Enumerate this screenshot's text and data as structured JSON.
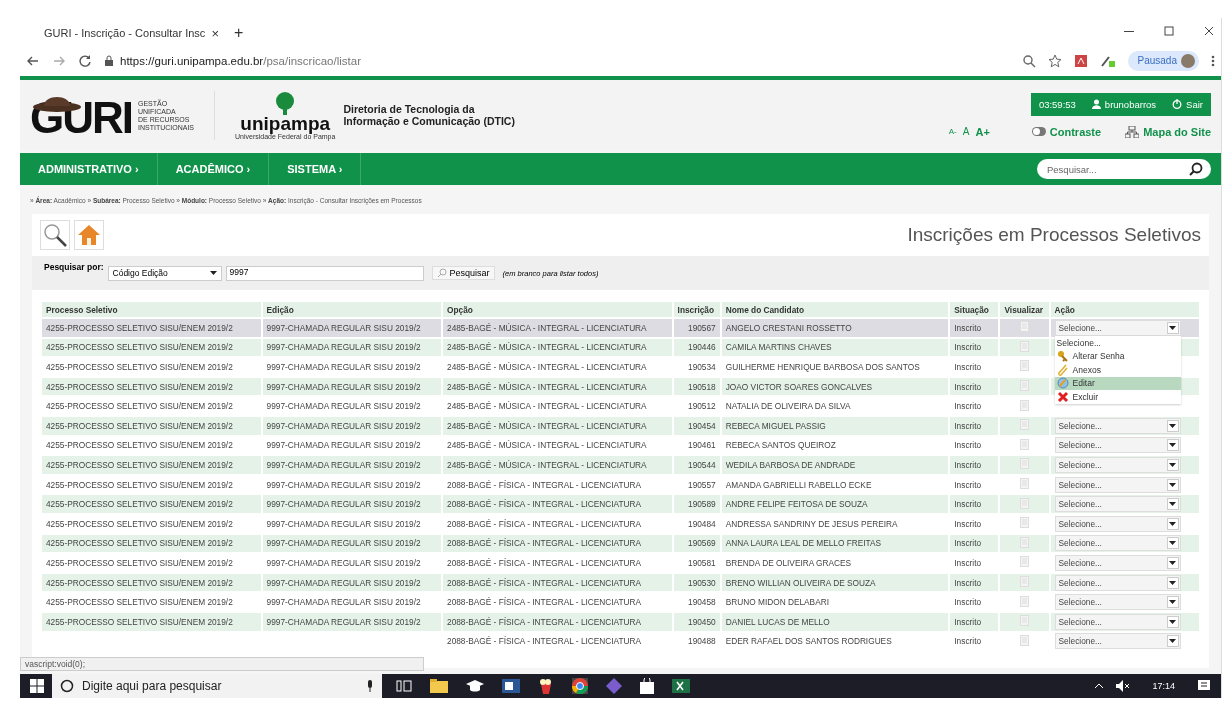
{
  "browser": {
    "tab_title": "GURI - Inscrição - Consultar Insc",
    "tab_close": "×",
    "new_tab": "+",
    "url_host": "https://guri.unipampa.edu.br",
    "url_path": "/psa/inscricao/listar",
    "profile": "Pausada"
  },
  "header": {
    "logo": "GURI",
    "tagline": [
      "GESTÃO",
      "UNIFICADA",
      "DE RECURSOS",
      "INSTITUCIONAIS"
    ],
    "uni_name": "unipampa",
    "uni_sub": "Universidade Federal do Pampa",
    "department": [
      "Diretoria de Tecnologia da",
      "Informação e Comunicação (DTIC)"
    ],
    "timer": "03:59:53",
    "user": "brunobarros",
    "logout": "Sair",
    "font_sizes": [
      "A-",
      "A",
      "A+"
    ],
    "contrast": "Contraste",
    "sitemap": "Mapa do Site"
  },
  "nav": {
    "items": [
      "ADMINISTRATIVO ›",
      "ACADÊMICO ›",
      "SISTEMA ›"
    ],
    "search_placeholder": "Pesquisar..."
  },
  "breadcrumb": "» **Área:** Acadêmico » **Subárea:** Processo Seletivo » **Módulo:** Processo Seletivo » **Ação:** Inscrição - Consultar Inscrições em Processos",
  "page_title": "Inscrições em Processos Seletivos",
  "search": {
    "label": "Pesquisar por:",
    "field": "Código Edição",
    "value": "9997",
    "button": "Pesquisar",
    "hint": "(em branco para listar todos)"
  },
  "table": {
    "columns": [
      "Processo Seletivo",
      "Edição",
      "Opção",
      "Inscrição",
      "Nome do Candidato",
      "Situação",
      "Visualizar",
      "Ação"
    ],
    "rows": [
      {
        "processo": "4255-PROCESSO SELETIVO SISU/ENEM 2019/2",
        "edicao": "9997-CHAMADA REGULAR SISU 2019/2",
        "opcao": "2485-BAGÉ - MÚSICA - INTEGRAL - LICENCIATURA",
        "inscricao": "190567",
        "nome": "ANGELO CRESTANI ROSSETTO",
        "situacao": "Inscrito",
        "acao": "Selecione...",
        "selected": true
      },
      {
        "processo": "4255-PROCESSO SELETIVO SISU/ENEM 2019/2",
        "edicao": "9997-CHAMADA REGULAR SISU 2019/2",
        "opcao": "2485-BAGÉ - MÚSICA - INTEGRAL - LICENCIATURA",
        "inscricao": "190446",
        "nome": "CAMILA MARTINS CHAVES",
        "situacao": "Inscrito",
        "selected": false
      },
      {
        "processo": "4255-PROCESSO SELETIVO SISU/ENEM 2019/2",
        "edicao": "9997-CHAMADA REGULAR SISU 2019/2",
        "opcao": "2485-BAGÉ - MÚSICA - INTEGRAL - LICENCIATURA",
        "inscricao": "190534",
        "nome": "GUILHERME HENRIQUE BARBOSA DOS SANTOS",
        "situacao": "Inscrito",
        "selected": false
      },
      {
        "processo": "4255-PROCESSO SELETIVO SISU/ENEM 2019/2",
        "edicao": "9997-CHAMADA REGULAR SISU 2019/2",
        "opcao": "2485-BAGÉ - MÚSICA - INTEGRAL - LICENCIATURA",
        "inscricao": "190518",
        "nome": "JOAO VICTOR SOARES GONCALVES",
        "situacao": "Inscrito",
        "selected": false
      },
      {
        "processo": "4255-PROCESSO SELETIVO SISU/ENEM 2019/2",
        "edicao": "9997-CHAMADA REGULAR SISU 2019/2",
        "opcao": "2485-BAGÉ - MÚSICA - INTEGRAL - LICENCIATURA",
        "inscricao": "190512",
        "nome": "NATALIA DE OLIVEIRA DA SILVA",
        "situacao": "Inscrito",
        "selected": false
      },
      {
        "processo": "4255-PROCESSO SELETIVO SISU/ENEM 2019/2",
        "edicao": "9997-CHAMADA REGULAR SISU 2019/2",
        "opcao": "2485-BAGÉ - MÚSICA - INTEGRAL - LICENCIATURA",
        "inscricao": "190454",
        "nome": "REBECA MIGUEL PASSIG",
        "situacao": "Inscrito",
        "acao": "Selecione...",
        "selected": false
      },
      {
        "processo": "4255-PROCESSO SELETIVO SISU/ENEM 2019/2",
        "edicao": "9997-CHAMADA REGULAR SISU 2019/2",
        "opcao": "2485-BAGÉ - MÚSICA - INTEGRAL - LICENCIATURA",
        "inscricao": "190461",
        "nome": "REBECA SANTOS QUEIROZ",
        "situacao": "Inscrito",
        "acao": "Selecione...",
        "selected": false
      },
      {
        "processo": "4255-PROCESSO SELETIVO SISU/ENEM 2019/2",
        "edicao": "9997-CHAMADA REGULAR SISU 2019/2",
        "opcao": "2485-BAGÉ - MÚSICA - INTEGRAL - LICENCIATURA",
        "inscricao": "190544",
        "nome": "WEDILA BARBOSA DE ANDRADE",
        "situacao": "Inscrito",
        "acao": "Selecione...",
        "selected": false
      },
      {
        "processo": "4255-PROCESSO SELETIVO SISU/ENEM 2019/2",
        "edicao": "9997-CHAMADA REGULAR SISU 2019/2",
        "opcao": "2088-BAGÉ - FÍSICA - INTEGRAL - LICENCIATURA",
        "inscricao": "190557",
        "nome": "AMANDA GABRIELLI RABELLO ECKE",
        "situacao": "Inscrito",
        "acao": "Selecione...",
        "selected": false
      },
      {
        "processo": "4255-PROCESSO SELETIVO SISU/ENEM 2019/2",
        "edicao": "9997-CHAMADA REGULAR SISU 2019/2",
        "opcao": "2088-BAGÉ - FÍSICA - INTEGRAL - LICENCIATURA",
        "inscricao": "190589",
        "nome": "ANDRE FELIPE FEITOSA DE SOUZA",
        "situacao": "Inscrito",
        "acao": "Selecione...",
        "selected": false
      },
      {
        "processo": "4255-PROCESSO SELETIVO SISU/ENEM 2019/2",
        "edicao": "9997-CHAMADA REGULAR SISU 2019/2",
        "opcao": "2088-BAGÉ - FÍSICA - INTEGRAL - LICENCIATURA",
        "inscricao": "190484",
        "nome": "ANDRESSA SANDRINY DE JESUS PEREIRA",
        "situacao": "Inscrito",
        "acao": "Selecione...",
        "selected": false
      },
      {
        "processo": "4255-PROCESSO SELETIVO SISU/ENEM 2019/2",
        "edicao": "9997-CHAMADA REGULAR SISU 2019/2",
        "opcao": "2088-BAGÉ - FÍSICA - INTEGRAL - LICENCIATURA",
        "inscricao": "190569",
        "nome": "ANNA LAURA LEAL DE MELLO FREITAS",
        "situacao": "Inscrito",
        "acao": "Selecione...",
        "selected": false
      },
      {
        "processo": "4255-PROCESSO SELETIVO SISU/ENEM 2019/2",
        "edicao": "9997-CHAMADA REGULAR SISU 2019/2",
        "opcao": "2088-BAGÉ - FÍSICA - INTEGRAL - LICENCIATURA",
        "inscricao": "190581",
        "nome": "BRENDA DE OLIVEIRA GRACES",
        "situacao": "Inscrito",
        "acao": "Selecione...",
        "selected": false
      },
      {
        "processo": "4255-PROCESSO SELETIVO SISU/ENEM 2019/2",
        "edicao": "9997-CHAMADA REGULAR SISU 2019/2",
        "opcao": "2088-BAGÉ - FÍSICA - INTEGRAL - LICENCIATURA",
        "inscricao": "190530",
        "nome": "BRENO WILLIAN OLIVEIRA DE SOUZA",
        "situacao": "Inscrito",
        "acao": "Selecione...",
        "selected": false
      },
      {
        "processo": "4255-PROCESSO SELETIVO SISU/ENEM 2019/2",
        "edicao": "9997-CHAMADA REGULAR SISU 2019/2",
        "opcao": "2088-BAGÉ - FÍSICA - INTEGRAL - LICENCIATURA",
        "inscricao": "190458",
        "nome": "BRUNO MIDON DELABARI",
        "situacao": "Inscrito",
        "acao": "Selecione...",
        "selected": false
      },
      {
        "processo": "4255-PROCESSO SELETIVO SISU/ENEM 2019/2",
        "edicao": "9997-CHAMADA REGULAR SISU 2019/2",
        "opcao": "2088-BAGÉ - FÍSICA - INTEGRAL - LICENCIATURA",
        "inscricao": "190450",
        "nome": "DANIEL LUCAS DE MELLO",
        "situacao": "Inscrito",
        "acao": "Selecione...",
        "selected": false
      },
      {
        "opcao": "2088-BAGÉ - FÍSICA - INTEGRAL - LICENCIATURA",
        "inscricao": "190488",
        "nome": "EDER RAFAEL DOS SANTOS RODRIGUES",
        "situacao": "Inscrito",
        "acao": "Selecione...",
        "selected": false
      }
    ]
  },
  "action_menu": {
    "options": [
      {
        "label": "Selecione...",
        "kind": "none",
        "selected": false
      },
      {
        "label": "Alterar Senha",
        "kind": "key",
        "selected": false
      },
      {
        "label": "Anexos",
        "kind": "clip",
        "selected": false
      },
      {
        "label": "Editar",
        "kind": "edit",
        "selected": true
      },
      {
        "label": "Excluir",
        "kind": "delete",
        "selected": false
      }
    ]
  },
  "status_text": "vascript:void(0);",
  "taskbar": {
    "search_placeholder": "Digite aqui para pesquisar",
    "time": "17:14"
  }
}
